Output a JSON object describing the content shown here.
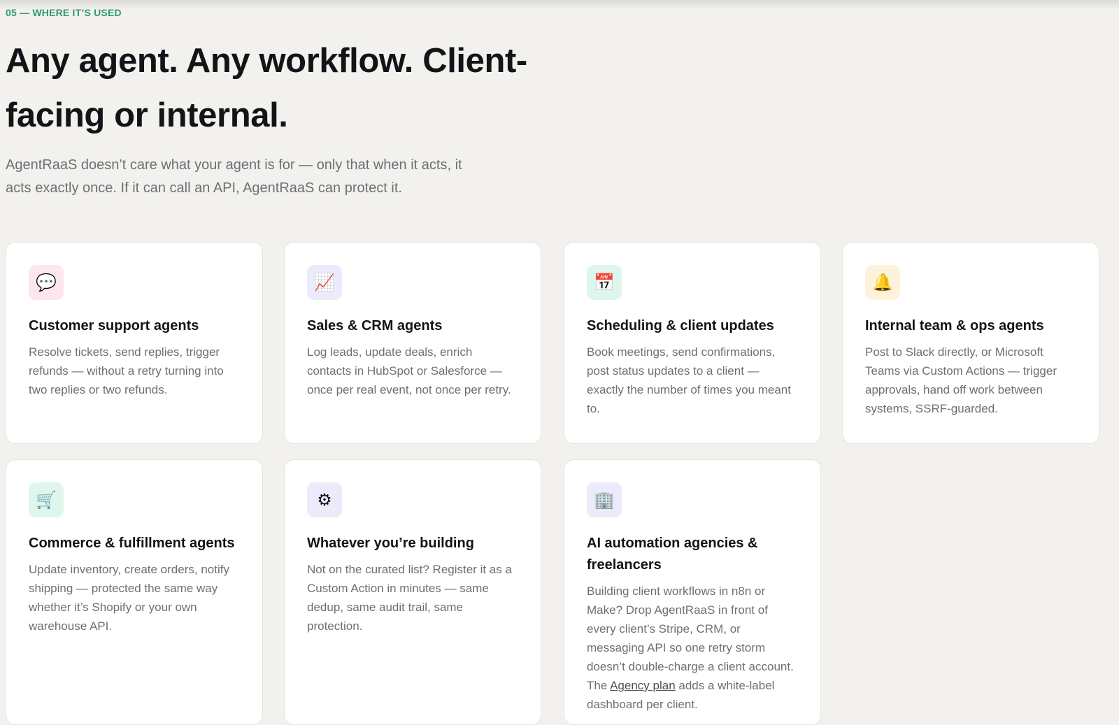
{
  "section": {
    "eyebrow": "05 — WHERE IT’S USED",
    "headline": "Any agent. Any workflow. Client-facing or internal.",
    "lede": "AgentRaaS doesn’t care what your agent is for — only that when it acts, it acts exactly once. If it can call an API, AgentRaaS can protect it."
  },
  "cards": [
    {
      "icon": "💬",
      "icon_name": "speech-bubble-icon",
      "icon_bg": "#fde7ec",
      "title": "Customer support agents",
      "desc": "Resolve tickets, send replies, trigger refunds — without a retry turning into two replies or two refunds."
    },
    {
      "icon": "📈",
      "icon_name": "chart-increasing-icon",
      "icon_bg": "#ecebfb",
      "title": "Sales & CRM agents",
      "desc": "Log leads, update deals, enrich contacts in HubSpot or Salesforce — once per real event, not once per retry."
    },
    {
      "icon": "📅",
      "icon_name": "calendar-icon",
      "icon_bg": "#dff6ee",
      "title": "Scheduling & client updates",
      "desc": "Book meetings, send confirmations, post status updates to a client — exactly the number of times you meant to."
    },
    {
      "icon": "🔔",
      "icon_name": "bell-icon",
      "icon_bg": "#fdf3dc",
      "title": "Internal team & ops agents",
      "desc": "Post to Slack directly, or Microsoft Teams via Custom Actions — trigger approvals, hand off work between systems, SSRF-guarded."
    },
    {
      "icon": "🛒",
      "icon_name": "shopping-cart-icon",
      "icon_bg": "#dff6ee",
      "title": "Commerce & fulfillment agents",
      "desc": "Update inventory, create orders, notify shipping — protected the same way whether it’s Shopify or your own warehouse API."
    },
    {
      "icon": "⚙",
      "icon_name": "gear-icon",
      "icon_bg": "#ecebfb",
      "title": "Whatever you’re building",
      "desc": "Not on the curated list? Register it as a Custom Action in minutes — same dedup, same audit trail, same protection."
    },
    {
      "icon": "🏢",
      "icon_name": "office-building-icon",
      "icon_bg": "#ecebfb",
      "title": "AI automation agencies & freelancers",
      "desc_before": "Building client workflows in n8n or Make? Drop AgentRaaS in front of every client’s Stripe, CRM, or messaging API so one retry storm doesn’t double-charge a client account. The ",
      "desc_link": "Agency plan",
      "desc_after": " adds a white-label dashboard per client."
    }
  ]
}
